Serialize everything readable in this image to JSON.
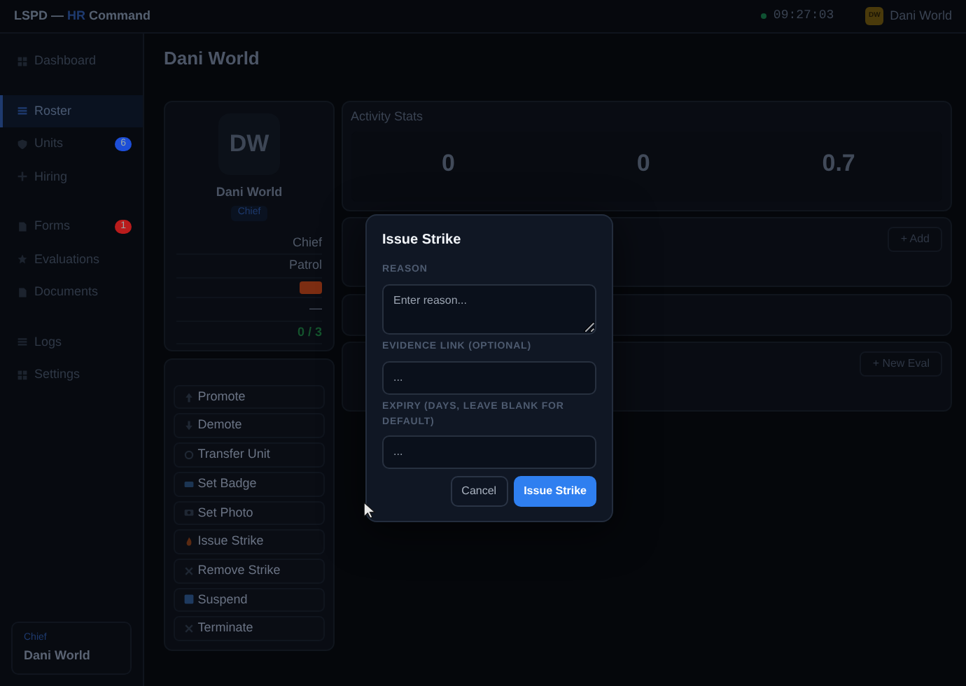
{
  "topbar": {
    "brand_prefix": "LSPD —",
    "brand_accent": "HR",
    "brand_suffix": "Command",
    "status_online": true,
    "clock": "09:27:03",
    "user": {
      "initials": "DW",
      "name": "Dani World"
    }
  },
  "sidebar": {
    "items": [
      {
        "label": "Dashboard",
        "kind": "grid",
        "selected": false
      },
      {
        "label": "Roster",
        "kind": "list",
        "selected": true
      },
      {
        "label": "Units",
        "kind": "shield",
        "selected": false,
        "badge": "6",
        "color": "#1d4ed8"
      },
      {
        "label": "Hiring",
        "kind": "plus",
        "selected": false
      },
      {
        "label": "Forms",
        "kind": "doc",
        "selected": false,
        "badge": "1",
        "color": "#b91c1c"
      },
      {
        "label": "Evaluations",
        "kind": "star",
        "selected": false
      },
      {
        "label": "Documents",
        "kind": "doc",
        "selected": false
      },
      {
        "label": "Logs",
        "kind": "list",
        "selected": false
      },
      {
        "label": "Settings",
        "kind": "grid",
        "selected": false
      }
    ],
    "footer": {
      "role": "Chief",
      "name": "Dani World"
    }
  },
  "page": {
    "title": "Dani World"
  },
  "profile": {
    "initials": "DW",
    "name": "Dani World",
    "rank": "Chief",
    "fields": [
      {
        "kind": "text",
        "value": "Chief"
      },
      {
        "kind": "text",
        "value": "Patrol"
      },
      {
        "kind": "tag",
        "color": "#7c2d12"
      },
      {
        "kind": "text",
        "value": "—"
      },
      {
        "kind": "good",
        "value": "0 / 3"
      }
    ]
  },
  "actions": [
    {
      "kind": "up",
      "label": "Promote"
    },
    {
      "kind": "down",
      "label": "Demote"
    },
    {
      "kind": "cycle",
      "label": "Transfer Unit"
    },
    {
      "kind": "badge",
      "label": "Set Badge"
    },
    {
      "kind": "photo",
      "label": "Set Photo"
    },
    {
      "kind": "alert",
      "label": "Issue Strike"
    },
    {
      "kind": "x",
      "label": "Remove Strike"
    },
    {
      "kind": "square",
      "label": "Suspend"
    },
    {
      "kind": "x",
      "label": "Terminate"
    }
  ],
  "stats": {
    "title": "Activity Stats",
    "values": [
      "0",
      "0",
      "0.7"
    ]
  },
  "panels": [
    {
      "kind": "action",
      "button": "+ Add"
    },
    {
      "kind": "plain"
    },
    {
      "kind": "action",
      "button": "+ New Eval"
    }
  ],
  "modal": {
    "title": "Issue Strike",
    "fields": [
      {
        "kind": "textarea",
        "label": "REASON",
        "placeholder": "Enter reason..."
      },
      {
        "kind": "input",
        "label": "EVIDENCE LINK (OPTIONAL)",
        "placeholder": "..."
      },
      {
        "kind": "input",
        "label": "EXPIRY (DAYS, LEAVE BLANK FOR DEFAULT)",
        "placeholder": "..."
      }
    ],
    "cancel": "Cancel",
    "submit": "Issue Strike"
  }
}
